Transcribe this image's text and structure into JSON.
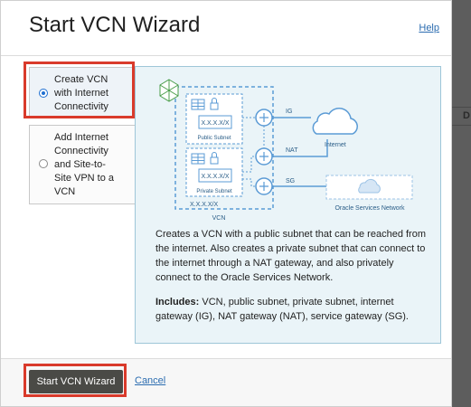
{
  "dialog": {
    "title": "Start VCN Wizard",
    "help_label": "Help"
  },
  "options": [
    {
      "lines": [
        "Create VCN",
        "with Internet",
        "Connectivity"
      ],
      "selected": true
    },
    {
      "lines": [
        "Add Internet",
        "Connectivity",
        "and Site-to-",
        "Site VPN to a",
        "VCN"
      ],
      "selected": false
    }
  ],
  "diagram": {
    "cidr_top": "X.X.X.X/X",
    "public_subnet_label": "Public Subnet",
    "cidr_private": "X.X.X.X/X",
    "private_subnet_label": "Private Subnet",
    "cidr_vcn": "X.X.X.X/X",
    "vcn_label": "VCN",
    "ig_label": "IG",
    "nat_label": "NAT",
    "sg_label": "SG",
    "internet_label": "Internet",
    "osn_label": "Oracle Services Network"
  },
  "description": "Creates a VCN with a public subnet that can be reached from the internet. Also creates a private subnet that can connect to the internet through a NAT gateway, and also privately connect to the Oracle Services Network.",
  "includes": {
    "label": "Includes:",
    "text": " VCN, public subnet, private subnet, internet gateway (IG), NAT gateway (NAT), service gateway (SG)."
  },
  "footer": {
    "primary_label": "Start VCN Wizard",
    "cancel_label": "Cancel"
  },
  "colors": {
    "accent_link": "#2b6cb0",
    "highlight": "#d93a2b",
    "primary_button": "#4a4a46",
    "diagram_blue": "#5b9bd5"
  }
}
